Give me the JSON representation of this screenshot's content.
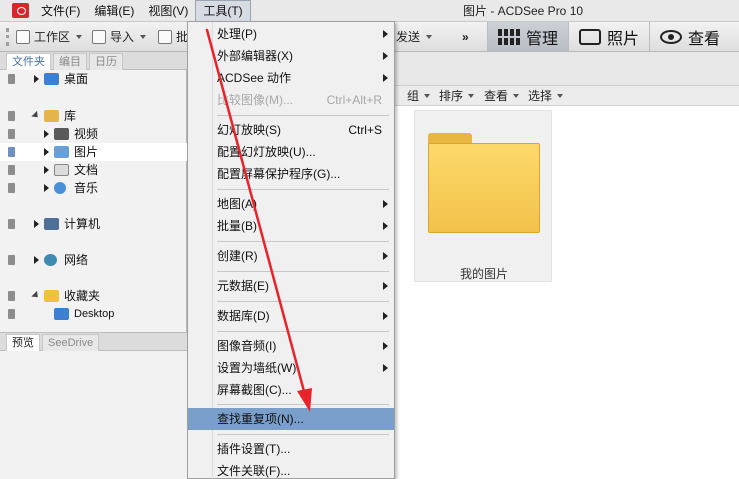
{
  "window": {
    "title": "图片 - ACDSee Pro 10",
    "app_icon": "acdsee-camera-icon"
  },
  "menubar": {
    "items": [
      {
        "label": "文件(F)"
      },
      {
        "label": "编辑(E)"
      },
      {
        "label": "视图(V)"
      },
      {
        "label": "工具(T)",
        "active": true
      }
    ]
  },
  "toolbar": {
    "workspace_label": "工作区",
    "import_label": "导入",
    "batch_label": "批",
    "send_label": "发送",
    "more_label": "»",
    "modes": [
      {
        "label": "管理",
        "icon": "grid-icon",
        "active": true
      },
      {
        "label": "照片",
        "icon": "tag-icon"
      },
      {
        "label": "查看",
        "icon": "eye-icon"
      }
    ]
  },
  "left_panel": {
    "tabs": [
      {
        "label": "文件夹",
        "active": true
      },
      {
        "label": "编目"
      },
      {
        "label": "日历"
      }
    ],
    "tree": [
      {
        "label": "桌面",
        "icon": "desktop-icon"
      },
      {
        "label": "库",
        "icon": "library-icon",
        "expanded": true
      },
      {
        "label": "视频",
        "icon": "video-icon"
      },
      {
        "label": "图片",
        "icon": "pictures-icon",
        "selected": true
      },
      {
        "label": "文档",
        "icon": "documents-icon"
      },
      {
        "label": "音乐",
        "icon": "music-icon"
      },
      {
        "label": "计算机",
        "icon": "computer-icon"
      },
      {
        "label": "网络",
        "icon": "network-icon"
      },
      {
        "label": "收藏夹",
        "icon": "favorites-icon",
        "expanded": true
      },
      {
        "label": "Desktop",
        "icon": "desktop-icon"
      }
    ],
    "preview_tabs": [
      {
        "label": "预览",
        "active": true
      },
      {
        "label": "SeeDrive"
      }
    ]
  },
  "content": {
    "subtoolbar": [
      {
        "label": "组"
      },
      {
        "label": "排序"
      },
      {
        "label": "查看"
      },
      {
        "label": "选择"
      }
    ],
    "thumbnails": [
      {
        "label": "我的图片",
        "icon": "folder-icon"
      }
    ]
  },
  "tools_menu": {
    "items": [
      {
        "label": "处理(P)",
        "submenu": true
      },
      {
        "label": "外部编辑器(X)",
        "submenu": true
      },
      {
        "label": "ACDSee 动作",
        "submenu": true
      },
      {
        "label": "比较图像(M)...",
        "shortcut": "Ctrl+Alt+R",
        "disabled": true
      },
      {
        "label": "幻灯放映(S)",
        "shortcut": "Ctrl+S"
      },
      {
        "label": "配置幻灯放映(U)..."
      },
      {
        "label": "配置屏幕保护程序(G)..."
      },
      {
        "label": "地图(A)",
        "submenu": true
      },
      {
        "label": "批量(B)",
        "submenu": true
      },
      {
        "label": "创建(R)",
        "submenu": true
      },
      {
        "label": "元数据(E)",
        "submenu": true
      },
      {
        "label": "数据库(D)",
        "submenu": true
      },
      {
        "label": "图像音频(I)",
        "submenu": true
      },
      {
        "label": "设置为墙纸(W)",
        "submenu": true
      },
      {
        "label": "屏幕截图(C)..."
      },
      {
        "label": "查找重复项(N)...",
        "highlighted": true
      },
      {
        "label": "插件设置(T)..."
      },
      {
        "label": "文件关联(F)..."
      }
    ]
  },
  "colors": {
    "menu_highlight": "#7a9fcb",
    "annotation_arrow": "#e8232a",
    "folder": "#f5c94f"
  }
}
